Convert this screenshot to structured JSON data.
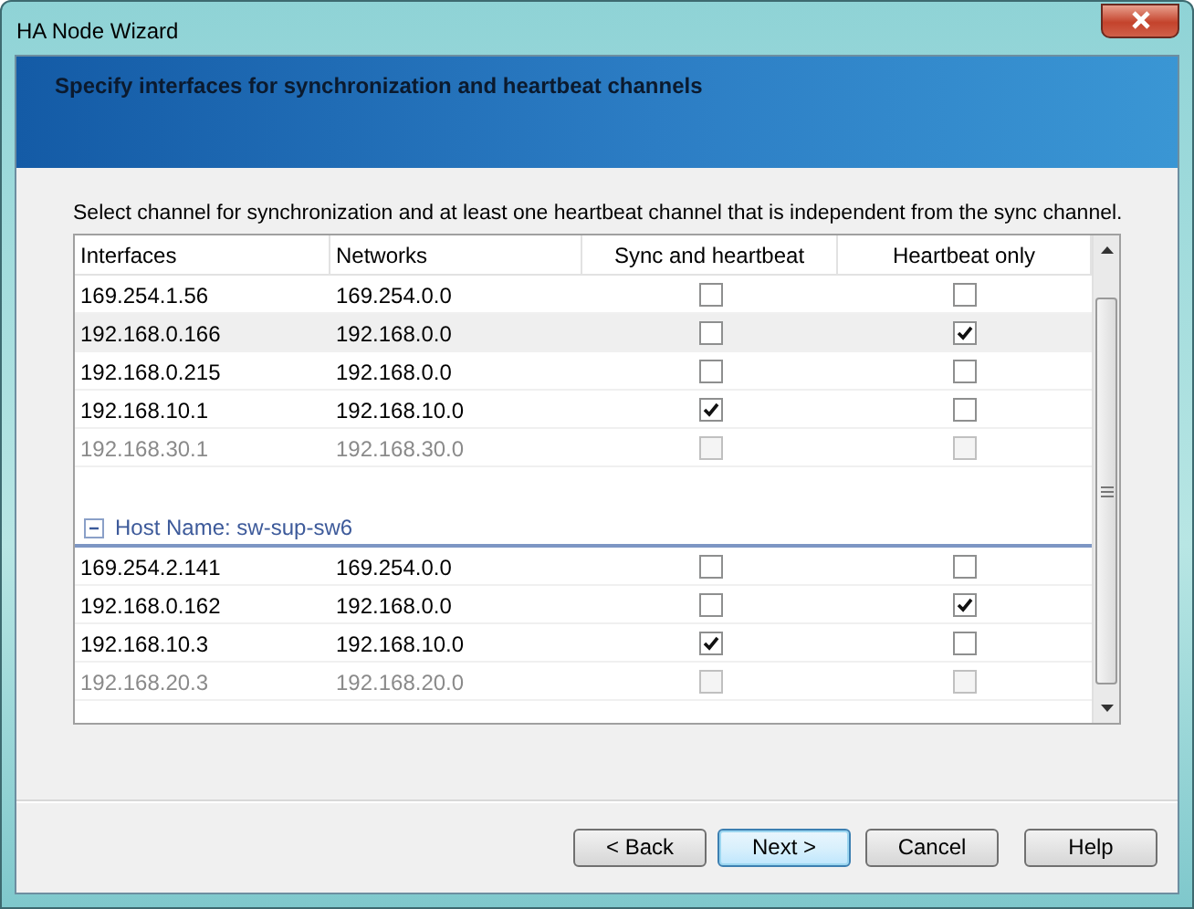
{
  "window": {
    "title": "HA Node Wizard"
  },
  "header": {
    "title": "Specify interfaces for synchronization and heartbeat channels"
  },
  "instruction": "Select channel for synchronization and at least one heartbeat channel that is independent from the sync channel.",
  "table": {
    "columns": [
      "Interfaces",
      "Networks",
      "Sync and heartbeat",
      "Heartbeat only"
    ],
    "groups": [
      {
        "rows": [
          {
            "interface": "169.254.1.56",
            "network": "169.254.0.0",
            "sync": false,
            "heartbeat": false,
            "disabled": false,
            "selected": false
          },
          {
            "interface": "192.168.0.166",
            "network": "192.168.0.0",
            "sync": false,
            "heartbeat": true,
            "disabled": false,
            "selected": true
          },
          {
            "interface": "192.168.0.215",
            "network": "192.168.0.0",
            "sync": false,
            "heartbeat": false,
            "disabled": false,
            "selected": false
          },
          {
            "interface": "192.168.10.1",
            "network": "192.168.10.0",
            "sync": true,
            "heartbeat": false,
            "disabled": false,
            "selected": false
          },
          {
            "interface": "192.168.30.1",
            "network": "192.168.30.0",
            "sync": false,
            "heartbeat": false,
            "disabled": true,
            "selected": false
          }
        ]
      },
      {
        "label": "Host Name: sw-sup-sw6",
        "expanded": true,
        "rows": [
          {
            "interface": "169.254.2.141",
            "network": "169.254.0.0",
            "sync": false,
            "heartbeat": false,
            "disabled": false,
            "selected": false
          },
          {
            "interface": "192.168.0.162",
            "network": "192.168.0.0",
            "sync": false,
            "heartbeat": true,
            "disabled": false,
            "selected": false
          },
          {
            "interface": "192.168.10.3",
            "network": "192.168.10.0",
            "sync": true,
            "heartbeat": false,
            "disabled": false,
            "selected": false
          },
          {
            "interface": "192.168.20.3",
            "network": "192.168.20.0",
            "sync": false,
            "heartbeat": false,
            "disabled": true,
            "selected": false
          }
        ]
      }
    ]
  },
  "buttons": [
    {
      "label": "< Back",
      "default": false
    },
    {
      "label": "Next >",
      "default": true
    },
    {
      "label": "Cancel",
      "default": false
    },
    {
      "label": "Help",
      "default": false
    }
  ]
}
